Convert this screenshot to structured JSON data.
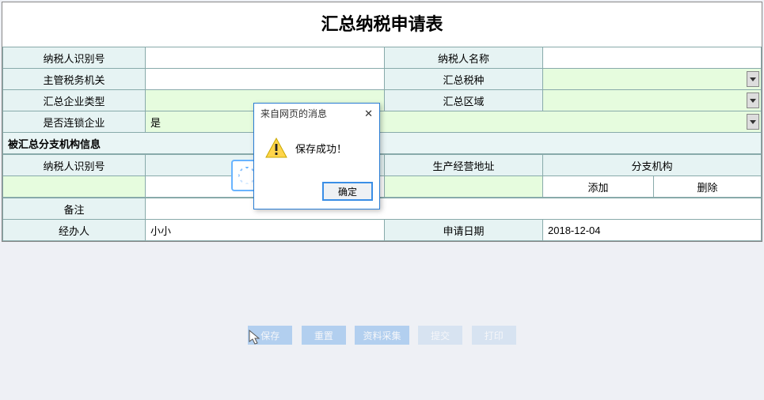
{
  "title": "汇总纳税申请表",
  "labels": {
    "taxpayer_id": "纳税人识别号",
    "taxpayer_name": "纳税人名称",
    "tax_authority": "主管税务机关",
    "summary_tax_type": "汇总税种",
    "summary_ent_type": "汇总企业类型",
    "summary_area": "汇总区域",
    "chain_enterprise": "是否连锁企业",
    "section_branches": "被汇总分支机构信息",
    "branch_taxpayer_id": "纳税人识别号",
    "branch_address": "生产经营地址",
    "branch_org": "分支机构",
    "add": "添加",
    "delete": "删除",
    "remark": "备注",
    "handler": "经办人",
    "apply_date": "申请日期"
  },
  "values": {
    "taxpayer_id": "",
    "taxpayer_name": "",
    "tax_authority": "",
    "summary_tax_type": "",
    "summary_ent_type": "",
    "summary_area": "",
    "chain_enterprise": "是",
    "branch_taxpayer_id": "",
    "branch_address": "",
    "remark": "",
    "handler": "小小",
    "apply_date": "2018-12-04"
  },
  "bottom_buttons": [
    "保存",
    "重置",
    "资料采集",
    "提交",
    "打印"
  ],
  "dialog": {
    "title": "来自网页的消息",
    "message": "保存成功！",
    "ok": "确定"
  }
}
